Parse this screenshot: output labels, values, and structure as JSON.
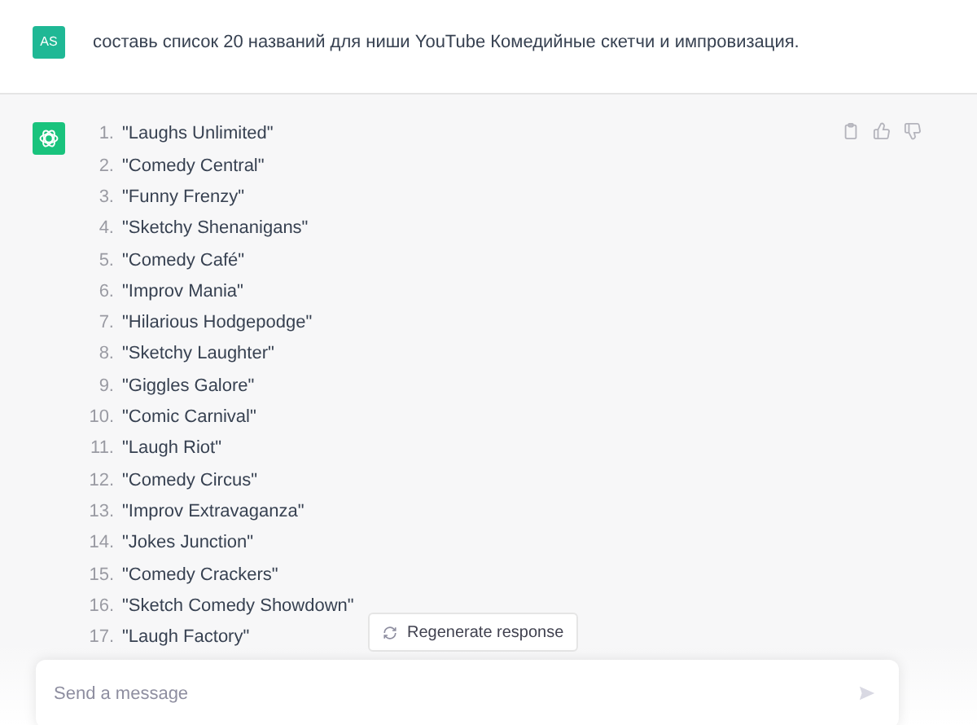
{
  "user_message": {
    "avatar": "AS",
    "text": "составь список 20 названий для ниши YouTube Комедийные скетчи и импровизация."
  },
  "assistant_message": {
    "items": [
      {
        "number": "1.",
        "text": "\"Laughs Unlimited\""
      },
      {
        "number": "2.",
        "text": "\"Comedy Central\""
      },
      {
        "number": "3.",
        "text": "\"Funny Frenzy\""
      },
      {
        "number": "4.",
        "text": "\"Sketchy Shenanigans\""
      },
      {
        "number": "5.",
        "text": "\"Comedy Café\""
      },
      {
        "number": "6.",
        "text": "\"Improv Mania\""
      },
      {
        "number": "7.",
        "text": "\"Hilarious Hodgepodge\""
      },
      {
        "number": "8.",
        "text": "\"Sketchy Laughter\""
      },
      {
        "number": "9.",
        "text": "\"Giggles Galore\""
      },
      {
        "number": "10.",
        "text": "\"Comic Carnival\""
      },
      {
        "number": "11.",
        "text": "\"Laugh Riot\""
      },
      {
        "number": "12.",
        "text": "\"Comedy Circus\""
      },
      {
        "number": "13.",
        "text": "\"Improv Extravaganza\""
      },
      {
        "number": "14.",
        "text": "\"Jokes Junction\""
      },
      {
        "number": "15.",
        "text": "\"Comedy Crackers\""
      },
      {
        "number": "16.",
        "text": "\"Sketch Comedy Showdown\""
      },
      {
        "number": "17.",
        "text": "\"Laugh Factory\""
      }
    ]
  },
  "regenerate_button": {
    "label": "Regenerate response"
  },
  "composer": {
    "placeholder": "Send a message"
  }
}
